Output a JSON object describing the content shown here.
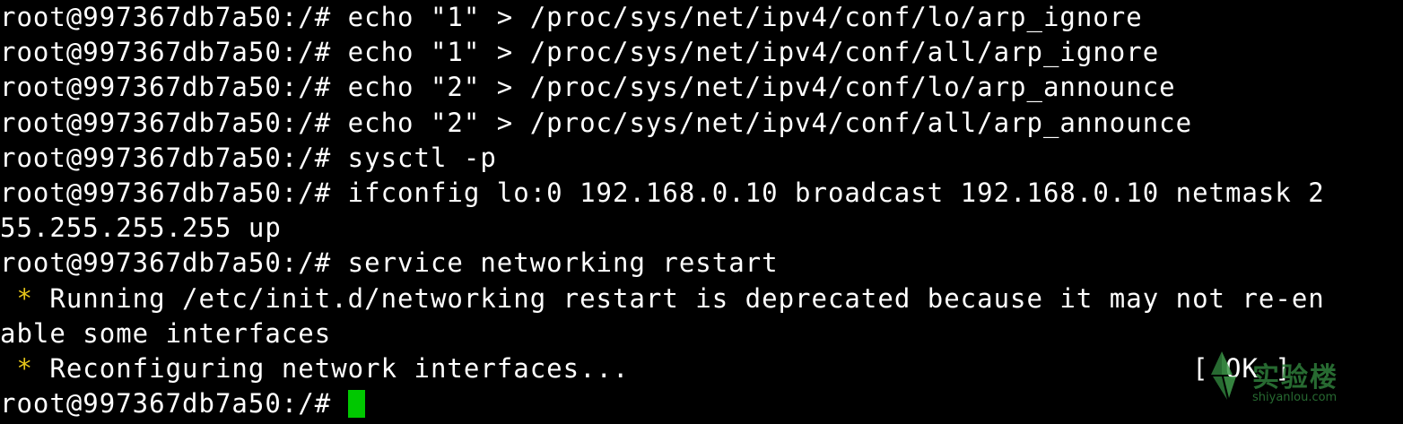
{
  "terminal": {
    "background": "#000000",
    "foreground": "#ffffff",
    "cursor_color": "#00c800",
    "bullet_color": "#e6c619",
    "lines": [
      {
        "text": "root@997367db7a50:/# echo \"1\" > /proc/sys/net/ipv4/conf/lo/arp_ignore"
      },
      {
        "text": "root@997367db7a50:/# echo \"1\" > /proc/sys/net/ipv4/conf/all/arp_ignore"
      },
      {
        "text": "root@997367db7a50:/# echo \"2\" > /proc/sys/net/ipv4/conf/lo/arp_announce"
      },
      {
        "text": "root@997367db7a50:/# echo \"2\" > /proc/sys/net/ipv4/conf/all/arp_announce"
      },
      {
        "text": "root@997367db7a50:/# sysctl -p"
      },
      {
        "text": "root@997367db7a50:/# ifconfig lo:0 192.168.0.10 broadcast 192.168.0.10 netmask 2"
      },
      {
        "text": "55.255.255.255 up"
      },
      {
        "text": "root@997367db7a50:/# service networking restart"
      },
      {
        "bullet": " *",
        "text": " Running /etc/init.d/networking restart is deprecated because it may not re-en"
      },
      {
        "text": "able some interfaces"
      },
      {
        "bullet": " *",
        "text": " Reconfiguring network interfaces...                                  [ OK ]"
      },
      {
        "text": "root@997367db7a50:/# "
      }
    ]
  },
  "watermark": {
    "title": "实验楼",
    "subtitle": "shiyanlou.com",
    "color": "#2e7d3a",
    "icon": "leaf-logo-icon"
  }
}
